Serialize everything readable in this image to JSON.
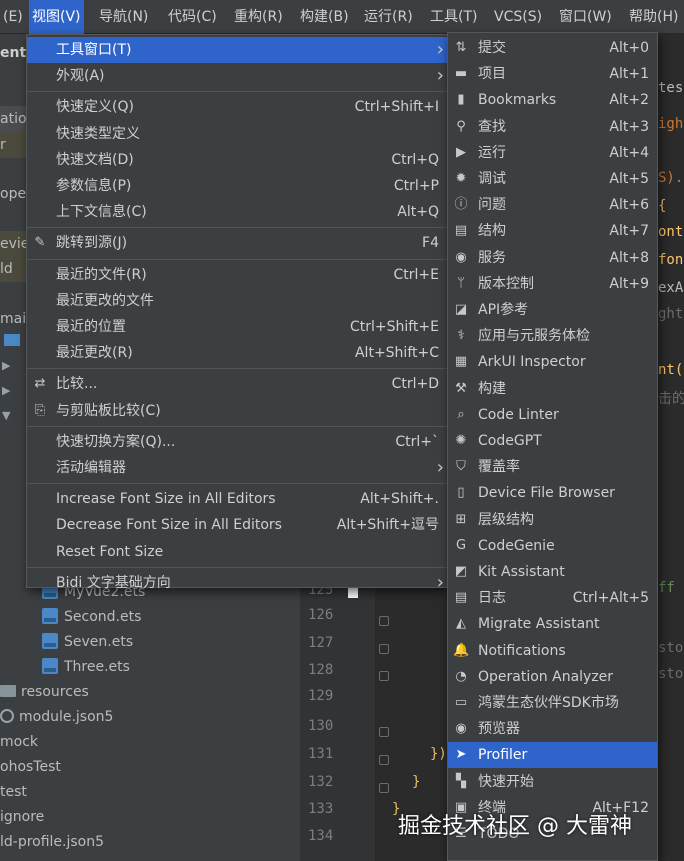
{
  "menubar": [
    "(E)",
    "视图(V)",
    "导航(N)",
    "代码(C)",
    "重构(R)",
    "构建(B)",
    "运行(R)",
    "工具(T)",
    "VCS(S)",
    "窗口(W)",
    "帮助(H)"
  ],
  "left_panel": {
    "frag1": "ent",
    "frag2": "atio",
    "frag3": "r",
    "frag4": "ope",
    "frag5": "evie",
    "frag6": "ld",
    "frag7": "mai",
    "files": [
      "MyVue2.ets",
      "Second.ets",
      "Seven.ets",
      "Three.ets"
    ],
    "tree": [
      "resources",
      "module.json5",
      "mock",
      "ohosTest",
      "test",
      "ignore",
      "ld-profile.json5"
    ]
  },
  "editor": {
    "line_numbers": [
      "125",
      "126",
      "127",
      "128",
      "129",
      "130",
      "131",
      "132",
      "133",
      "134"
    ],
    "frag_tab": "test",
    "frag_igh": "igh",
    "frag_s": "S).c",
    "frag_brace": "{",
    "frag_font": "ont",
    "frag_font2": "font",
    "frag_ex": "exA",
    "frag_ght": "ght",
    "frag_nt": "nt(",
    "frag_cn": "击的",
    "frag_ff": "ff",
    "frag_stop1": "stop",
    "frag_stop2": "stop",
    "code_131": "})",
    "code_132": "}",
    "code_133": "}"
  },
  "menu_view": [
    {
      "label": "工具窗口(T)",
      "shortcut": "",
      "submenu": true,
      "selected": true
    },
    {
      "label": "外观(A)",
      "shortcut": "",
      "submenu": true
    },
    {
      "sep": true
    },
    {
      "label": "快速定义(Q)",
      "shortcut": "Ctrl+Shift+I"
    },
    {
      "label": "快速类型定义",
      "shortcut": ""
    },
    {
      "label": "快速文档(D)",
      "shortcut": "Ctrl+Q"
    },
    {
      "label": "参数信息(P)",
      "shortcut": "Ctrl+P"
    },
    {
      "label": "上下文信息(C)",
      "shortcut": "Alt+Q"
    },
    {
      "sep": true
    },
    {
      "label": "跳转到源(J)",
      "shortcut": "F4",
      "icon": "pencil-icon"
    },
    {
      "sep": true
    },
    {
      "label": "最近的文件(R)",
      "shortcut": "Ctrl+E"
    },
    {
      "label": "最近更改的文件",
      "shortcut": ""
    },
    {
      "label": "最近的位置",
      "shortcut": "Ctrl+Shift+E"
    },
    {
      "label": "最近更改(R)",
      "shortcut": "Alt+Shift+C"
    },
    {
      "sep": true
    },
    {
      "label": "比较...",
      "shortcut": "Ctrl+D",
      "icon": "compare-icon"
    },
    {
      "label": "与剪贴板比较(C)",
      "shortcut": "",
      "icon": "clipboard-compare-icon"
    },
    {
      "sep": true
    },
    {
      "label": "快速切换方案(Q)...",
      "shortcut": "Ctrl+`"
    },
    {
      "label": "活动编辑器",
      "shortcut": "",
      "submenu": true
    },
    {
      "sep": true
    },
    {
      "label": "Increase Font Size in All Editors",
      "shortcut": "Alt+Shift+."
    },
    {
      "label": "Decrease Font Size in All Editors",
      "shortcut": "Alt+Shift+逗号"
    },
    {
      "label": "Reset Font Size",
      "shortcut": ""
    },
    {
      "sep": true
    },
    {
      "label": "Bidi 文字基础方向",
      "shortcut": "",
      "submenu": true
    }
  ],
  "menu_tools": [
    {
      "label": "提交",
      "shortcut": "Alt+0",
      "icon": "commit-icon"
    },
    {
      "label": "项目",
      "shortcut": "Alt+1",
      "icon": "folder-icon"
    },
    {
      "label": "Bookmarks",
      "shortcut": "Alt+2",
      "icon": "bookmark-icon"
    },
    {
      "label": "查找",
      "shortcut": "Alt+3",
      "icon": "search-icon"
    },
    {
      "label": "运行",
      "shortcut": "Alt+4",
      "icon": "run-icon"
    },
    {
      "label": "调试",
      "shortcut": "Alt+5",
      "icon": "bug-icon"
    },
    {
      "label": "问题",
      "shortcut": "Alt+6",
      "icon": "info-icon"
    },
    {
      "label": "结构",
      "shortcut": "Alt+7",
      "icon": "structure-icon"
    },
    {
      "label": "服务",
      "shortcut": "Alt+8",
      "icon": "services-icon"
    },
    {
      "label": "版本控制",
      "shortcut": "Alt+9",
      "icon": "vcs-icon"
    },
    {
      "label": "API参考",
      "shortcut": "",
      "icon": "api-icon"
    },
    {
      "label": "应用与元服务体检",
      "shortcut": "",
      "icon": "checkup-icon"
    },
    {
      "label": "ArkUI Inspector",
      "shortcut": "",
      "icon": "inspector-icon"
    },
    {
      "label": "构建",
      "shortcut": "",
      "icon": "hammer-icon"
    },
    {
      "label": "Code Linter",
      "shortcut": "",
      "icon": "linter-icon"
    },
    {
      "label": "CodeGPT",
      "shortcut": "",
      "icon": "codegpt-icon"
    },
    {
      "label": "覆盖率",
      "shortcut": "",
      "icon": "shield-icon"
    },
    {
      "label": "Device File Browser",
      "shortcut": "",
      "icon": "device-icon"
    },
    {
      "label": "层级结构",
      "shortcut": "",
      "icon": "hierarchy-icon"
    },
    {
      "label": "CodeGenie",
      "shortcut": "",
      "icon": "codegenie-icon"
    },
    {
      "label": "Kit Assistant",
      "shortcut": "",
      "icon": "kit-icon"
    },
    {
      "label": "日志",
      "shortcut": "Ctrl+Alt+5",
      "icon": "log-icon"
    },
    {
      "label": "Migrate Assistant",
      "shortcut": "",
      "icon": "migrate-icon"
    },
    {
      "label": "Notifications",
      "shortcut": "",
      "icon": "bell-icon"
    },
    {
      "label": "Operation Analyzer",
      "shortcut": "",
      "icon": "analyzer-icon"
    },
    {
      "label": "鸿蒙生态伙伴SDK市场",
      "shortcut": "",
      "icon": "sdk-icon"
    },
    {
      "label": "预览器",
      "shortcut": "",
      "icon": "previewer-icon"
    },
    {
      "label": "Profiler",
      "shortcut": "",
      "icon": "profiler-icon",
      "selected": true
    },
    {
      "label": "快速开始",
      "shortcut": "",
      "icon": "quickstart-icon"
    },
    {
      "label": "终端",
      "shortcut": "Alt+F12",
      "icon": "terminal-icon"
    },
    {
      "label": "TODO",
      "shortcut": "",
      "icon": "todo-icon"
    }
  ],
  "watermark": "掘金技术社区 @ 大雷神",
  "colors": {
    "accent": "#2f65ca",
    "menu_bg": "#3c3f41",
    "editor_bg": "#2b2b2b"
  }
}
